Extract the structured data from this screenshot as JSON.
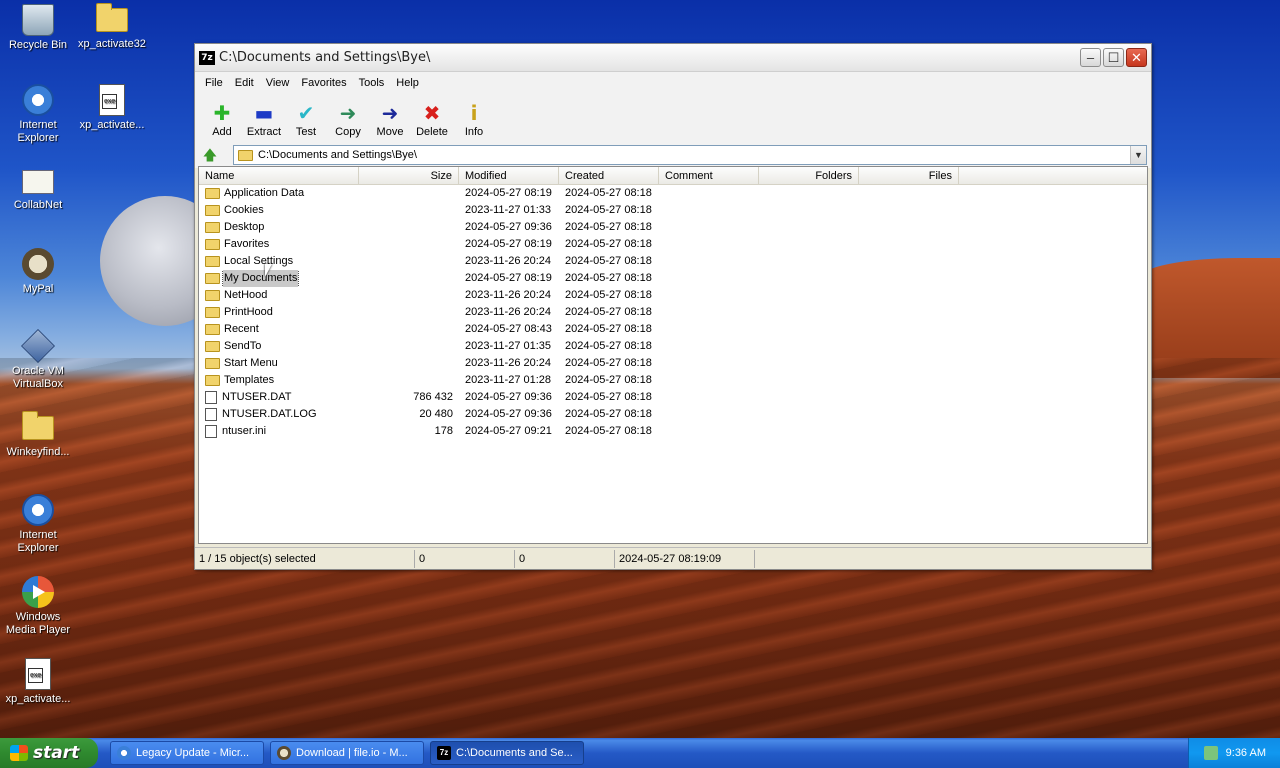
{
  "desktop": {
    "icons": [
      {
        "label": "Recycle Bin",
        "icon": "recycle-bin-icon"
      },
      {
        "label": "xp_activate32",
        "icon": "folder-icon"
      },
      {
        "label": "Internet Explorer",
        "icon": "internet-explorer-icon"
      },
      {
        "label": "xp_activate...",
        "icon": "executable-icon"
      },
      {
        "label": "CollabNet",
        "icon": "collabnet-icon"
      },
      {
        "label": "MyPal",
        "icon": "mypal-icon"
      },
      {
        "label": "Oracle VM VirtualBox",
        "icon": "virtualbox-icon"
      },
      {
        "label": "Winkeyfind...",
        "icon": "folder-icon"
      },
      {
        "label": "Internet Explorer",
        "icon": "internet-explorer-icon"
      },
      {
        "label": "Windows Media Player",
        "icon": "media-player-icon"
      },
      {
        "label": "xp_activate...",
        "icon": "executable-icon"
      }
    ]
  },
  "window": {
    "title": "C:\\Documents and Settings\\Bye\\",
    "app_icon": "7z",
    "menu": [
      "File",
      "Edit",
      "View",
      "Favorites",
      "Tools",
      "Help"
    ],
    "toolbar": [
      {
        "label": "Add",
        "icon": "add-icon",
        "glyph": "✚",
        "color": "#2bb52b"
      },
      {
        "label": "Extract",
        "icon": "extract-icon",
        "glyph": "▬",
        "color": "#1d3ac6"
      },
      {
        "label": "Test",
        "icon": "test-icon",
        "glyph": "✔",
        "color": "#2ab7c8"
      },
      {
        "label": "Copy",
        "icon": "copy-icon",
        "glyph": "➜",
        "color": "#2f8a5a"
      },
      {
        "label": "Move",
        "icon": "move-icon",
        "glyph": "➜",
        "color": "#1d2a9a"
      },
      {
        "label": "Delete",
        "icon": "delete-icon",
        "glyph": "✖",
        "color": "#d8201c"
      },
      {
        "label": "Info",
        "icon": "info-icon",
        "glyph": "i",
        "color": "#c9a21a"
      }
    ],
    "address": "C:\\Documents and Settings\\Bye\\",
    "columns": [
      "Name",
      "Size",
      "Modified",
      "Created",
      "Comment",
      "Folders",
      "Files"
    ],
    "rows": [
      {
        "name": "Application Data",
        "type": "folder",
        "size": "",
        "modified": "2024-05-27 08:19",
        "created": "2024-05-27 08:18"
      },
      {
        "name": "Cookies",
        "type": "folder",
        "size": "",
        "modified": "2023-11-27 01:33",
        "created": "2024-05-27 08:18"
      },
      {
        "name": "Desktop",
        "type": "folder",
        "size": "",
        "modified": "2024-05-27 09:36",
        "created": "2024-05-27 08:18"
      },
      {
        "name": "Favorites",
        "type": "folder",
        "size": "",
        "modified": "2024-05-27 08:19",
        "created": "2024-05-27 08:18"
      },
      {
        "name": "Local Settings",
        "type": "folder",
        "size": "",
        "modified": "2023-11-26 20:24",
        "created": "2024-05-27 08:18"
      },
      {
        "name": "My Documents",
        "type": "folder",
        "size": "",
        "modified": "2024-05-27 08:19",
        "created": "2024-05-27 08:18",
        "selected": true
      },
      {
        "name": "NetHood",
        "type": "folder",
        "size": "",
        "modified": "2023-11-26 20:24",
        "created": "2024-05-27 08:18"
      },
      {
        "name": "PrintHood",
        "type": "folder",
        "size": "",
        "modified": "2023-11-26 20:24",
        "created": "2024-05-27 08:18"
      },
      {
        "name": "Recent",
        "type": "folder",
        "size": "",
        "modified": "2024-05-27 08:43",
        "created": "2024-05-27 08:18"
      },
      {
        "name": "SendTo",
        "type": "folder",
        "size": "",
        "modified": "2023-11-27 01:35",
        "created": "2024-05-27 08:18"
      },
      {
        "name": "Start Menu",
        "type": "folder",
        "size": "",
        "modified": "2023-11-26 20:24",
        "created": "2024-05-27 08:18"
      },
      {
        "name": "Templates",
        "type": "folder",
        "size": "",
        "modified": "2023-11-27 01:28",
        "created": "2024-05-27 08:18"
      },
      {
        "name": "NTUSER.DAT",
        "type": "file",
        "size": "786 432",
        "modified": "2024-05-27 09:36",
        "created": "2024-05-27 08:18"
      },
      {
        "name": "NTUSER.DAT.LOG",
        "type": "file",
        "size": "20 480",
        "modified": "2024-05-27 09:36",
        "created": "2024-05-27 08:18"
      },
      {
        "name": "ntuser.ini",
        "type": "file",
        "size": "178",
        "modified": "2024-05-27 09:21",
        "created": "2024-05-27 08:18"
      }
    ],
    "status": {
      "selection": "1 / 15 object(s) selected",
      "size": "0",
      "packed": "0",
      "modified": "2024-05-27 08:19:09"
    }
  },
  "taskbar": {
    "start_label": "start",
    "tasks": [
      {
        "label": "Legacy Update - Micr...",
        "icon": "ie-icon",
        "active": false
      },
      {
        "label": "Download | file.io - M...",
        "icon": "mypal-icon",
        "active": false
      },
      {
        "label": "C:\\Documents and Se...",
        "icon": "7zip-icon",
        "active": true
      }
    ],
    "clock": "9:36 AM"
  }
}
